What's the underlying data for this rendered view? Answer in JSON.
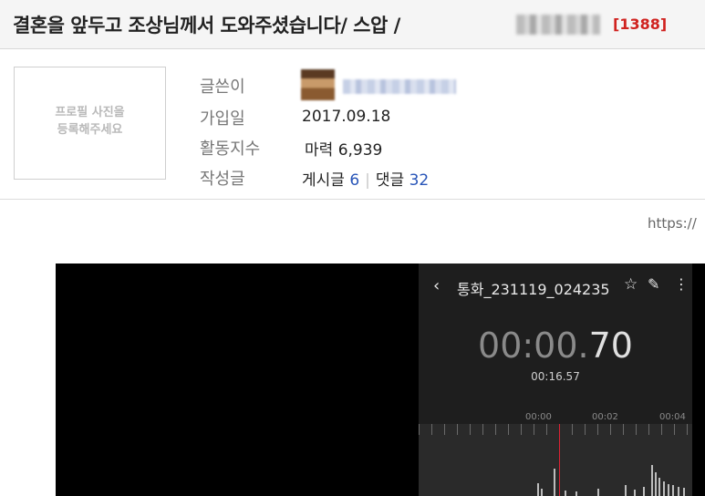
{
  "post": {
    "title": "결혼을 앞두고 조상님께서 도와주셨습니다/ 스압 /",
    "view_count": "[1388]"
  },
  "profile": {
    "placeholder_line1": "프로필 사진을",
    "placeholder_line2": "등록해주세요"
  },
  "info": {
    "author_label": "글쓴이",
    "join_label": "가입일",
    "join_date": "2017.09.18",
    "activity_label": "활동지수",
    "activity_prefix": "마력",
    "activity_value": "6,939",
    "writings_label": "작성글",
    "posts_label": "게시글",
    "posts_count": "6",
    "comments_label": "댓글",
    "comments_count": "32"
  },
  "url_fragment": "https://",
  "recording": {
    "back_icon": "chevron-left-icon",
    "title": "통화_231119_024235",
    "icons": [
      "star-icon",
      "pencil-icon",
      "more-vertical-icon"
    ],
    "elapsed_main": "00:00.",
    "elapsed_fraction": "70",
    "total": "00:16.57",
    "timeline_labels": [
      "00:00",
      "00:02",
      "00:04"
    ],
    "accent": "#dd2233"
  }
}
